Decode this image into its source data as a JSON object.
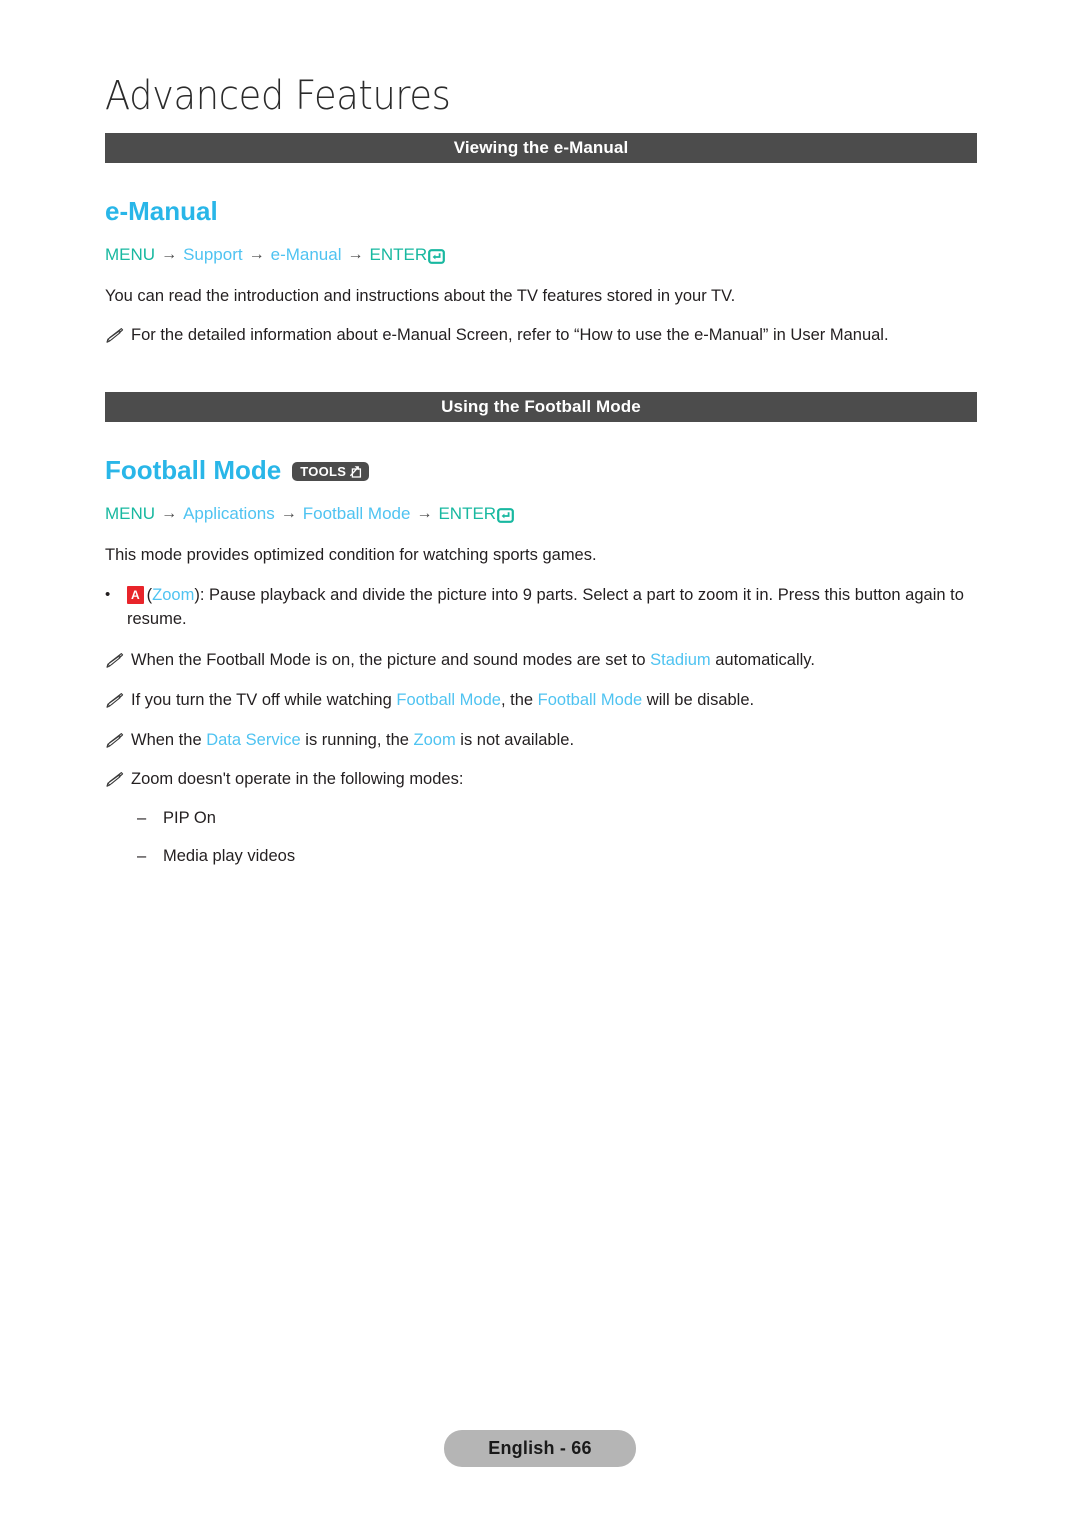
{
  "page": {
    "title": "Advanced Features",
    "footer_label": "English - 66"
  },
  "colors": {
    "heading_blue": "#29b6e8",
    "link_blue": "#4fc3f1",
    "menu_green": "#18b8a0",
    "bar_gray": "#4c4c4c",
    "key_red": "#e8242a",
    "footer_gray": "#b5b5b5"
  },
  "sections": [
    {
      "bar_label": "Viewing the e-Manual",
      "heading": "e-Manual",
      "menu_path": {
        "root": "MENU",
        "arrow": "→",
        "steps": [
          "Support",
          "e-Manual"
        ],
        "enter": "ENTER",
        "enter_icon": "enter-return-icon"
      },
      "paragraph": "You can read the introduction and instructions about the TV features stored in your TV.",
      "notes": [
        "For the detailed information about e-Manual Screen, refer to “How to use the e-Manual” in User Manual."
      ]
    },
    {
      "bar_label": "Using the Football Mode",
      "heading": "Football Mode",
      "badge": {
        "label": "TOOLS",
        "icon": "tools-arrow-icon"
      },
      "menu_path": {
        "root": "MENU",
        "arrow": "→",
        "steps": [
          "Applications",
          "Football Mode"
        ],
        "enter": "ENTER",
        "enter_icon": "enter-return-icon"
      },
      "paragraph": "This mode provides optimized condition for watching sports games.",
      "bullet": {
        "dot": "•",
        "key_label": "A",
        "key_name": "Zoom",
        "open_paren": "(",
        "close_paren": "):",
        "text": " Pause playback and divide the picture into 9 parts. Select a part to zoom it in. Press this button again to resume."
      },
      "notes_rich": [
        [
          {
            "t": "When the Football Mode is on, the picture and sound modes are set to ",
            "hl": false
          },
          {
            "t": "Stadium",
            "hl": true
          },
          {
            "t": " automatically.",
            "hl": false
          }
        ],
        [
          {
            "t": "If you turn the TV off while watching ",
            "hl": false
          },
          {
            "t": "Football Mode",
            "hl": true
          },
          {
            "t": ", the ",
            "hl": false
          },
          {
            "t": "Football Mode",
            "hl": true
          },
          {
            "t": " will be disable.",
            "hl": false
          }
        ],
        [
          {
            "t": "When the ",
            "hl": false
          },
          {
            "t": "Data Service",
            "hl": true
          },
          {
            "t": " is running, the ",
            "hl": false
          },
          {
            "t": "Zoom",
            "hl": true
          },
          {
            "t": " is not available.",
            "hl": false
          }
        ],
        [
          {
            "t": "Zoom doesn't operate in the following modes:",
            "hl": false
          }
        ]
      ],
      "sub_items": {
        "dash": "–",
        "items": [
          "PIP On",
          "Media play videos"
        ]
      }
    }
  ]
}
